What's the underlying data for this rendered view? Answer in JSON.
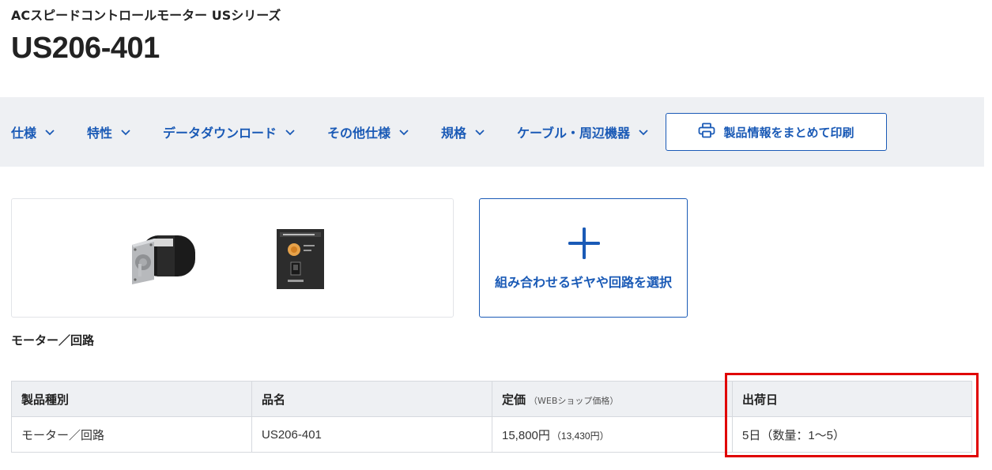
{
  "header": {
    "series": "ACスピードコントロールモーター USシリーズ",
    "model": "US206-401"
  },
  "nav": {
    "items": [
      {
        "label": "仕様"
      },
      {
        "label": "特性"
      },
      {
        "label": "データダウンロード"
      },
      {
        "label": "その他仕様"
      },
      {
        "label": "規格"
      },
      {
        "label": "ケーブル・周辺機器"
      }
    ],
    "print_label": "製品情報をまとめて印刷"
  },
  "product_image": {
    "caption": "モーター／回路"
  },
  "combo": {
    "label": "組み合わせるギヤや回路を選択"
  },
  "table": {
    "headers": {
      "type": "製品種別",
      "name": "品名",
      "price": "定価",
      "price_note": "（WEBショップ価格）",
      "ship": "出荷日"
    },
    "row": {
      "type": "モーター／回路",
      "name": "US206-401",
      "price": "15,800円",
      "price_web": "（13,430円）",
      "ship": "5日（数量：1〜5）"
    }
  },
  "colors": {
    "accent": "#1a5ab6",
    "highlight": "#e00000",
    "nav_bg": "#eef0f3"
  }
}
